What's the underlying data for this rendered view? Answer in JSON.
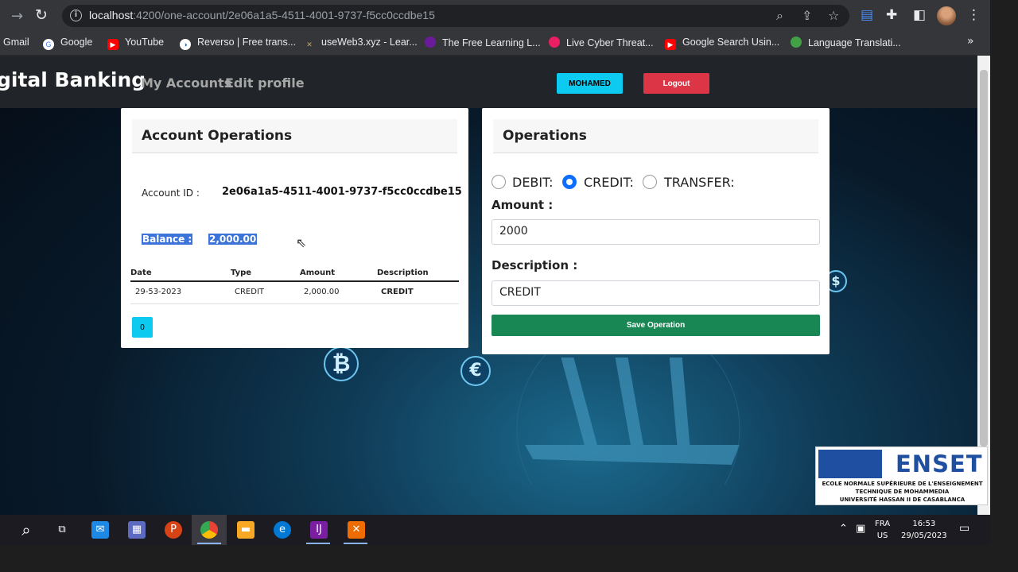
{
  "browser": {
    "url_host": "localhost",
    "url_path": ":4200/one-account/2e06a1a5-4511-4001-9737-f5cc0ccdbe15",
    "bookmarks": [
      {
        "label": "Gmail",
        "color": "#35363a"
      },
      {
        "label": "Google",
        "color": "#4285f4"
      },
      {
        "label": "YouTube",
        "color": "#ff0000"
      },
      {
        "label": "Reverso | Free trans...",
        "color": "#1a73e8"
      },
      {
        "label": "useWeb3.xyz - Lear...",
        "color": "#8d6e63"
      },
      {
        "label": "The Free Learning L...",
        "color": "#6a1b9a"
      },
      {
        "label": "Live Cyber Threat...",
        "color": "#e91e63"
      },
      {
        "label": "Google Search Usin...",
        "color": "#ff0000"
      },
      {
        "label": "Language Translati...",
        "color": "#43a047"
      }
    ],
    "more": "»"
  },
  "navbar": {
    "brand": "gital Banking",
    "links": [
      "My Accounts",
      "Edit profile"
    ],
    "user_button": "MOHAMED",
    "logout_button": "Logout"
  },
  "account_card": {
    "title": "Account Operations",
    "account_id_label": "Account ID :",
    "account_id": "2e06a1a5-4511-4001-9737-f5cc0ccdbe15",
    "balance_label": "Balance :",
    "balance": "2,000.00",
    "columns": [
      "Date",
      "Type",
      "Amount",
      "Description"
    ],
    "row": {
      "date": "29-53-2023",
      "type": "CREDIT",
      "amount": "2,000.00",
      "description": "CREDIT"
    },
    "page": "0"
  },
  "operations_card": {
    "title": "Operations",
    "options": [
      "DEBIT:",
      "CREDIT:",
      "TRANSFER:"
    ],
    "selected": "CREDIT:",
    "amount_label": "Amount :",
    "amount_value": "2000",
    "description_label": "Description :",
    "description_value": "CREDIT",
    "save_button": "Save Operation"
  },
  "watermark": {
    "name": "ENSET",
    "lines": [
      "ECOLE NORMALE SUPÉRIEURE DE L'ENSEIGNEMENT",
      "TECHNIQUE DE MOHAMMEDIA",
      "UNIVERSITÉ HASSAN II DE CASABLANCA"
    ]
  },
  "taskbar": {
    "lang": "FRA",
    "region": "US",
    "time": "16:53",
    "date": "29/05/2023"
  }
}
